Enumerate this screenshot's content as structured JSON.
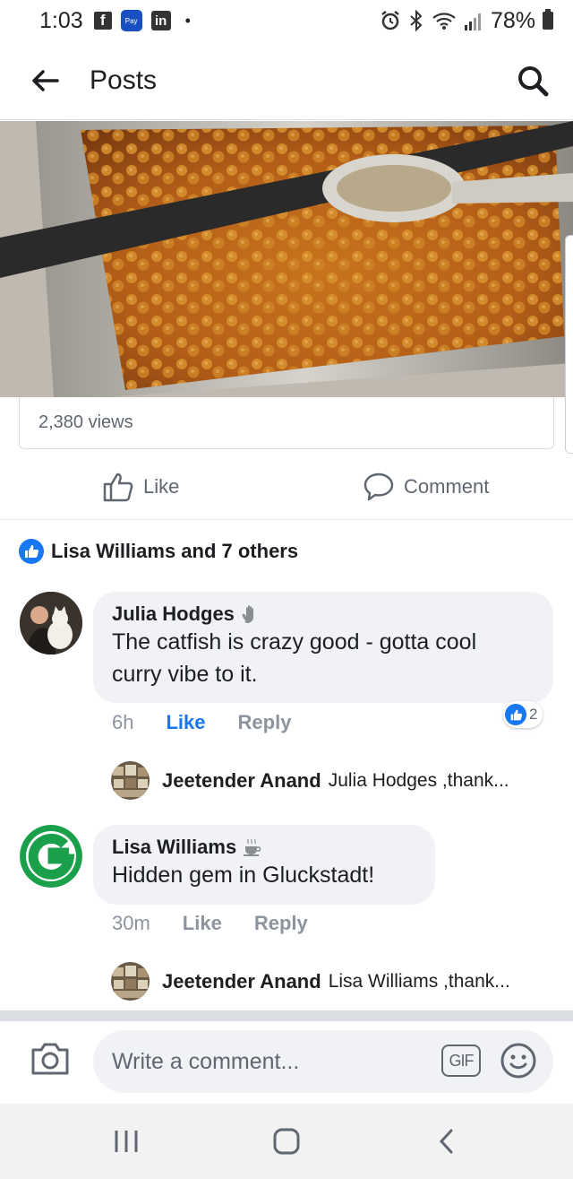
{
  "status_bar": {
    "time": "1:03",
    "battery": "78%",
    "icons": [
      "facebook-icon",
      "pay-icon",
      "linkedin-icon",
      "alarm-icon",
      "bluetooth-icon",
      "wifi-icon",
      "signal-icon",
      "battery-icon"
    ],
    "pay_label": "Pay",
    "dot": "•",
    "fb_glyph": "f",
    "in_glyph": "in"
  },
  "header": {
    "title": "Posts"
  },
  "video": {
    "views": "2,380 views"
  },
  "actions": {
    "like_label": "Like",
    "comment_label": "Comment"
  },
  "reactions": {
    "summary": "Lisa Williams and 7 others"
  },
  "comments": [
    {
      "name": "Julia Hodges",
      "badge_icon": "wave-hand-icon",
      "text_line1": "The catfish is crazy good - gotta cool",
      "text_line2": "curry vibe to it.",
      "time": "6h",
      "like": "Like",
      "reply": "Reply",
      "reaction_count": "2",
      "like_color": "#1877f2",
      "reply_preview": {
        "name": "Jeetender Anand",
        "text": "Julia Hodges ,thank..."
      }
    },
    {
      "name": "Lisa Williams",
      "badge_icon": "coffee-cup-icon",
      "text": "Hidden gem in Gluckstadt!",
      "time": "30m",
      "like": "Like",
      "reply": "Reply",
      "reply_preview": {
        "name": "Jeetender Anand",
        "text": "Lisa Williams ,thank..."
      }
    }
  ],
  "composer": {
    "placeholder": "Write a comment...",
    "gif_label": "GIF"
  },
  "colors": {
    "facebook_blue": "#1877f2",
    "bubble_gray": "#f0f2f5",
    "meta_gray": "#8d949e",
    "g_logo_green": "#1aa04a"
  }
}
